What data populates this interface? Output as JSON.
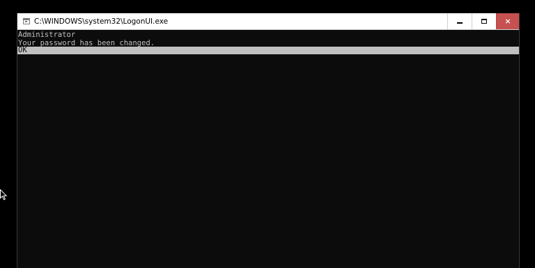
{
  "window": {
    "title": "C:\\WINDOWS\\system32\\LogonUI.exe",
    "icon": "console-app-icon",
    "controls": {
      "minimize": "minimize-icon",
      "maximize": "maximize-icon",
      "close": "×"
    },
    "colors": {
      "titlebar": "#ffffff",
      "close_button": "#c75050",
      "console_background": "#0c0c0c",
      "console_text": "#c0c0c0",
      "selection_highlight": "#c0c0c0"
    }
  },
  "console": {
    "lines": [
      "Administrator",
      "Your password has been changed."
    ],
    "selected_option": "OK"
  },
  "desktop": {
    "background": "#000000",
    "pointer": "mouse-pointer-icon"
  }
}
